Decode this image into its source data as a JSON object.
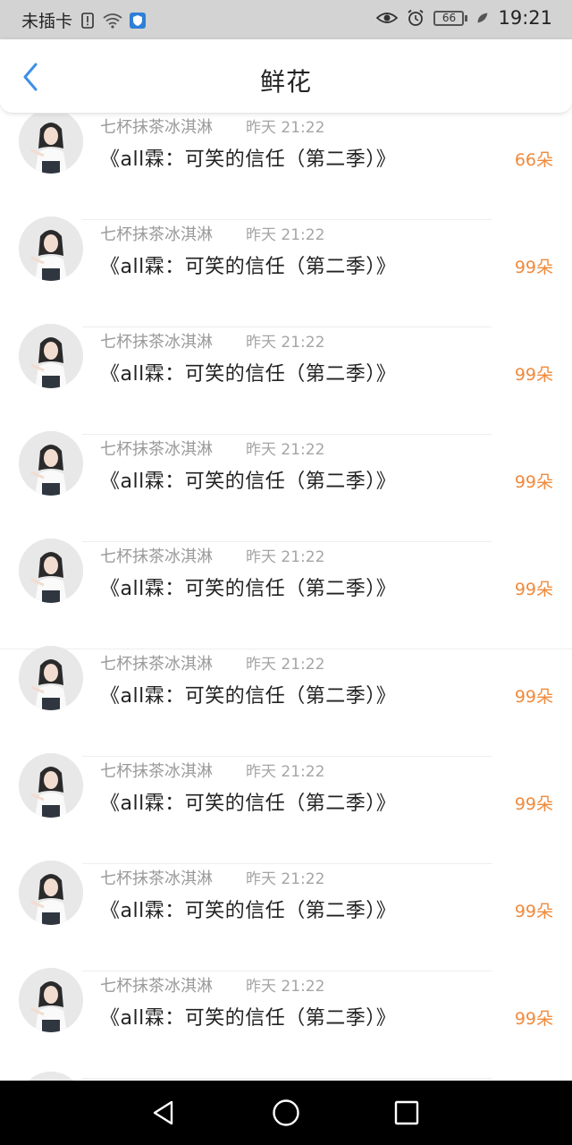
{
  "status_bar": {
    "carrier": "未插卡",
    "time": "19:21",
    "battery_level": "66",
    "icons": [
      "sim-alert-icon",
      "wifi-icon",
      "shield-icon",
      "eye-icon",
      "alarm-icon",
      "battery-icon",
      "leaf-icon"
    ]
  },
  "header": {
    "title": "鲜花",
    "back_icon": "chevron-left-icon"
  },
  "list": {
    "items": [
      {
        "name": "七杯抹茶冰淇淋",
        "time": "昨天 21:22",
        "book": "《all霖：可笑的信任（第二季）》",
        "count": "66朵"
      },
      {
        "name": "七杯抹茶冰淇淋",
        "time": "昨天 21:22",
        "book": "《all霖：可笑的信任（第二季）》",
        "count": "99朵"
      },
      {
        "name": "七杯抹茶冰淇淋",
        "time": "昨天 21:22",
        "book": "《all霖：可笑的信任（第二季）》",
        "count": "99朵"
      },
      {
        "name": "七杯抹茶冰淇淋",
        "time": "昨天 21:22",
        "book": "《all霖：可笑的信任（第二季）》",
        "count": "99朵"
      },
      {
        "name": "七杯抹茶冰淇淋",
        "time": "昨天 21:22",
        "book": "《all霖：可笑的信任（第二季）》",
        "count": "99朵"
      },
      {
        "name": "七杯抹茶冰淇淋",
        "time": "昨天 21:22",
        "book": "《all霖：可笑的信任（第二季）》",
        "count": "99朵"
      },
      {
        "name": "七杯抹茶冰淇淋",
        "time": "昨天 21:22",
        "book": "《all霖：可笑的信任（第二季）》",
        "count": "99朵"
      },
      {
        "name": "七杯抹茶冰淇淋",
        "time": "昨天 21:22",
        "book": "《all霖：可笑的信任（第二季）》",
        "count": "99朵"
      },
      {
        "name": "七杯抹茶冰淇淋",
        "time": "昨天 21:22",
        "book": "《all霖：可笑的信任（第二季）》",
        "count": "99朵"
      }
    ]
  },
  "nav_bar": {
    "icons": [
      "back-triangle-icon",
      "home-circle-icon",
      "recents-square-icon"
    ]
  },
  "colors": {
    "accent_blue": "#3d8fe6",
    "count_orange": "#f08a3c",
    "status_bg": "#d3d3d3",
    "nav_bg": "#000000"
  }
}
